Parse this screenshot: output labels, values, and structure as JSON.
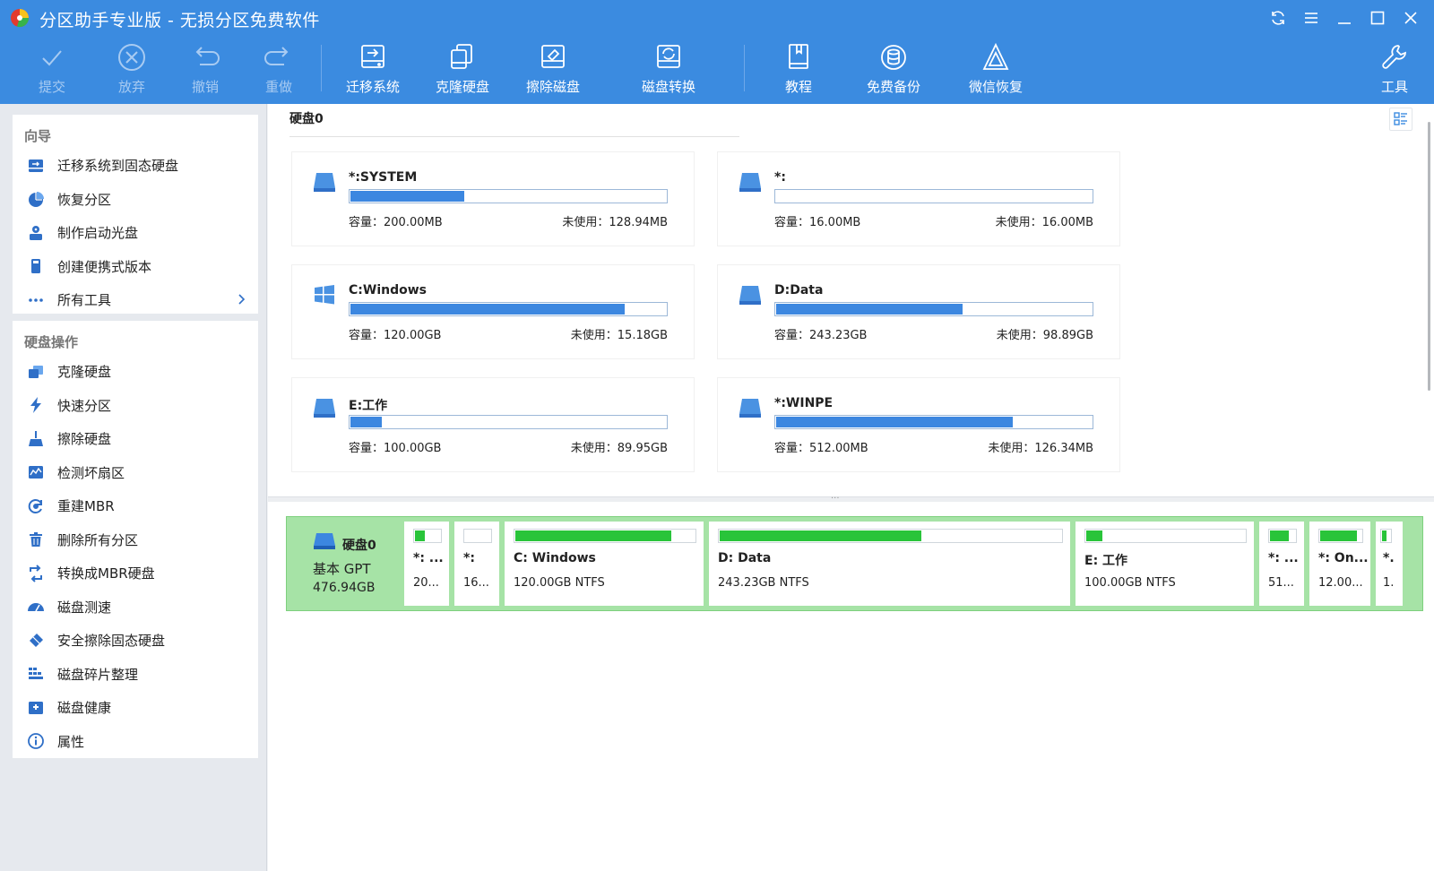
{
  "window": {
    "title": "分区助手专业版 - 无损分区免费软件"
  },
  "toolbar": {
    "commit": "提交",
    "discard": "放弃",
    "undo": "撤销",
    "redo": "重做",
    "migrate": "迁移系统",
    "clone": "克隆硬盘",
    "wipe": "擦除磁盘",
    "convert": "磁盘转换",
    "tutorial": "教程",
    "backup": "免费备份",
    "wechat": "微信恢复",
    "tools": "工具"
  },
  "sidebar": {
    "wizard_title": "向导",
    "wizard_items": [
      {
        "label": "迁移系统到固态硬盘",
        "icon": "migrate-disk-icon"
      },
      {
        "label": "恢复分区",
        "icon": "pie-chart-icon"
      },
      {
        "label": "制作启动光盘",
        "icon": "boot-disc-icon"
      },
      {
        "label": "创建便携式版本",
        "icon": "portable-icon"
      },
      {
        "label": "所有工具",
        "icon": "more-icon"
      }
    ],
    "disk_ops_title": "硬盘操作",
    "disk_items": [
      {
        "label": "克隆硬盘",
        "icon": "clone-disk-icon"
      },
      {
        "label": "快速分区",
        "icon": "lightning-icon"
      },
      {
        "label": "擦除硬盘",
        "icon": "broom-icon"
      },
      {
        "label": "检测坏扇区",
        "icon": "sector-scan-icon"
      },
      {
        "label": "重建MBR",
        "icon": "rebuild-icon"
      },
      {
        "label": "删除所有分区",
        "icon": "trash-icon"
      },
      {
        "label": "转换成MBR硬盘",
        "icon": "convert-icon"
      },
      {
        "label": "磁盘测速",
        "icon": "speedometer-icon"
      },
      {
        "label": "安全擦除固态硬盘",
        "icon": "eraser-icon"
      },
      {
        "label": "磁盘碎片整理",
        "icon": "defrag-icon"
      },
      {
        "label": "磁盘健康",
        "icon": "health-icon"
      },
      {
        "label": "属性",
        "icon": "info-icon"
      }
    ]
  },
  "main": {
    "disk_title": "硬盘0",
    "partitions": [
      {
        "name": "*:SYSTEM",
        "capacity": "容量：200.00MB",
        "free": "未使用：128.94MB",
        "used_fraction": 0.36,
        "icon": "drive-icon"
      },
      {
        "name": "*:",
        "capacity": "容量：16.00MB",
        "free": "未使用：16.00MB",
        "used_fraction": 0.0,
        "icon": "drive-icon"
      },
      {
        "name": "C:Windows",
        "capacity": "容量：120.00GB",
        "free": "未使用：15.18GB",
        "used_fraction": 0.87,
        "icon": "windows-icon"
      },
      {
        "name": "D:Data",
        "capacity": "容量：243.23GB",
        "free": "未使用：98.89GB",
        "used_fraction": 0.59,
        "icon": "drive-icon"
      },
      {
        "name": "E:工作",
        "capacity": "容量：100.00GB",
        "free": "未使用：89.95GB",
        "used_fraction": 0.1,
        "icon": "drive-icon"
      },
      {
        "name": "*:WINPE",
        "capacity": "容量：512.00MB",
        "free": "未使用：126.34MB",
        "used_fraction": 0.75,
        "icon": "drive-icon"
      }
    ]
  },
  "diskmap": {
    "name": "硬盘0",
    "type": "基本 GPT",
    "size": "476.94GB",
    "segments": [
      {
        "label": "*: ...",
        "info": "20...",
        "used_fraction": 0.4
      },
      {
        "label": "*:",
        "info": "16...",
        "used_fraction": 0.0
      },
      {
        "label": "C: Windows",
        "info": "120.00GB NTFS",
        "used_fraction": 0.87
      },
      {
        "label": "D: Data",
        "info": "243.23GB NTFS",
        "used_fraction": 0.59
      },
      {
        "label": "E: 工作",
        "info": "100.00GB NTFS",
        "used_fraction": 0.1
      },
      {
        "label": "*: ...",
        "info": "51...",
        "used_fraction": 0.75
      },
      {
        "label": "*: On...",
        "info": "12.00...",
        "used_fraction": 0.9
      },
      {
        "label": "*.",
        "info": "1.",
        "used_fraction": 0.5
      }
    ]
  },
  "colors": {
    "titlebar": "#3b8be0",
    "partition_bar": "#3c87e0",
    "diskmap_green": "#a6e3a6",
    "segment_bar": "#29c43a"
  }
}
